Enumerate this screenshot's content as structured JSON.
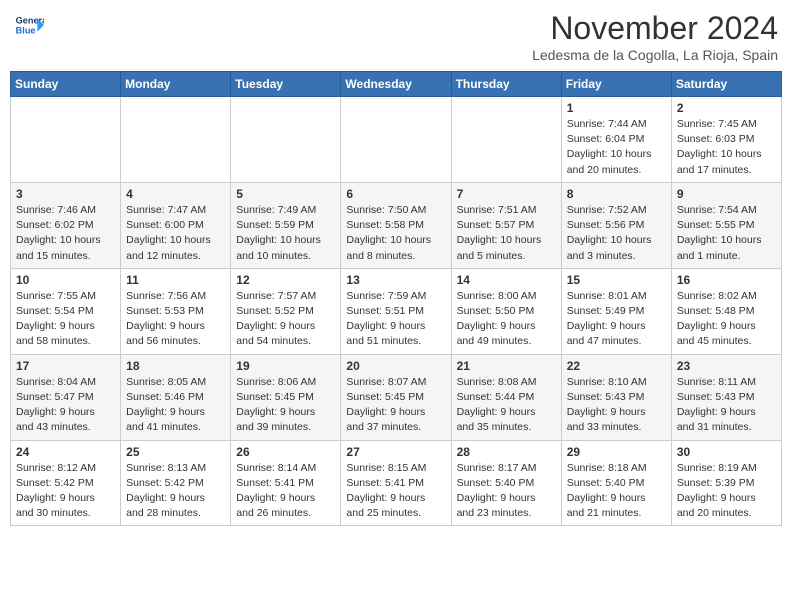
{
  "header": {
    "logo_line1": "General",
    "logo_line2": "Blue",
    "month": "November 2024",
    "location": "Ledesma de la Cogolla, La Rioja, Spain"
  },
  "weekdays": [
    "Sunday",
    "Monday",
    "Tuesday",
    "Wednesday",
    "Thursday",
    "Friday",
    "Saturday"
  ],
  "weeks": [
    [
      {
        "day": "",
        "text": ""
      },
      {
        "day": "",
        "text": ""
      },
      {
        "day": "",
        "text": ""
      },
      {
        "day": "",
        "text": ""
      },
      {
        "day": "",
        "text": ""
      },
      {
        "day": "1",
        "text": "Sunrise: 7:44 AM\nSunset: 6:04 PM\nDaylight: 10 hours and 20 minutes."
      },
      {
        "day": "2",
        "text": "Sunrise: 7:45 AM\nSunset: 6:03 PM\nDaylight: 10 hours and 17 minutes."
      }
    ],
    [
      {
        "day": "3",
        "text": "Sunrise: 7:46 AM\nSunset: 6:02 PM\nDaylight: 10 hours and 15 minutes."
      },
      {
        "day": "4",
        "text": "Sunrise: 7:47 AM\nSunset: 6:00 PM\nDaylight: 10 hours and 12 minutes."
      },
      {
        "day": "5",
        "text": "Sunrise: 7:49 AM\nSunset: 5:59 PM\nDaylight: 10 hours and 10 minutes."
      },
      {
        "day": "6",
        "text": "Sunrise: 7:50 AM\nSunset: 5:58 PM\nDaylight: 10 hours and 8 minutes."
      },
      {
        "day": "7",
        "text": "Sunrise: 7:51 AM\nSunset: 5:57 PM\nDaylight: 10 hours and 5 minutes."
      },
      {
        "day": "8",
        "text": "Sunrise: 7:52 AM\nSunset: 5:56 PM\nDaylight: 10 hours and 3 minutes."
      },
      {
        "day": "9",
        "text": "Sunrise: 7:54 AM\nSunset: 5:55 PM\nDaylight: 10 hours and 1 minute."
      }
    ],
    [
      {
        "day": "10",
        "text": "Sunrise: 7:55 AM\nSunset: 5:54 PM\nDaylight: 9 hours and 58 minutes."
      },
      {
        "day": "11",
        "text": "Sunrise: 7:56 AM\nSunset: 5:53 PM\nDaylight: 9 hours and 56 minutes."
      },
      {
        "day": "12",
        "text": "Sunrise: 7:57 AM\nSunset: 5:52 PM\nDaylight: 9 hours and 54 minutes."
      },
      {
        "day": "13",
        "text": "Sunrise: 7:59 AM\nSunset: 5:51 PM\nDaylight: 9 hours and 51 minutes."
      },
      {
        "day": "14",
        "text": "Sunrise: 8:00 AM\nSunset: 5:50 PM\nDaylight: 9 hours and 49 minutes."
      },
      {
        "day": "15",
        "text": "Sunrise: 8:01 AM\nSunset: 5:49 PM\nDaylight: 9 hours and 47 minutes."
      },
      {
        "day": "16",
        "text": "Sunrise: 8:02 AM\nSunset: 5:48 PM\nDaylight: 9 hours and 45 minutes."
      }
    ],
    [
      {
        "day": "17",
        "text": "Sunrise: 8:04 AM\nSunset: 5:47 PM\nDaylight: 9 hours and 43 minutes."
      },
      {
        "day": "18",
        "text": "Sunrise: 8:05 AM\nSunset: 5:46 PM\nDaylight: 9 hours and 41 minutes."
      },
      {
        "day": "19",
        "text": "Sunrise: 8:06 AM\nSunset: 5:45 PM\nDaylight: 9 hours and 39 minutes."
      },
      {
        "day": "20",
        "text": "Sunrise: 8:07 AM\nSunset: 5:45 PM\nDaylight: 9 hours and 37 minutes."
      },
      {
        "day": "21",
        "text": "Sunrise: 8:08 AM\nSunset: 5:44 PM\nDaylight: 9 hours and 35 minutes."
      },
      {
        "day": "22",
        "text": "Sunrise: 8:10 AM\nSunset: 5:43 PM\nDaylight: 9 hours and 33 minutes."
      },
      {
        "day": "23",
        "text": "Sunrise: 8:11 AM\nSunset: 5:43 PM\nDaylight: 9 hours and 31 minutes."
      }
    ],
    [
      {
        "day": "24",
        "text": "Sunrise: 8:12 AM\nSunset: 5:42 PM\nDaylight: 9 hours and 30 minutes."
      },
      {
        "day": "25",
        "text": "Sunrise: 8:13 AM\nSunset: 5:42 PM\nDaylight: 9 hours and 28 minutes."
      },
      {
        "day": "26",
        "text": "Sunrise: 8:14 AM\nSunset: 5:41 PM\nDaylight: 9 hours and 26 minutes."
      },
      {
        "day": "27",
        "text": "Sunrise: 8:15 AM\nSunset: 5:41 PM\nDaylight: 9 hours and 25 minutes."
      },
      {
        "day": "28",
        "text": "Sunrise: 8:17 AM\nSunset: 5:40 PM\nDaylight: 9 hours and 23 minutes."
      },
      {
        "day": "29",
        "text": "Sunrise: 8:18 AM\nSunset: 5:40 PM\nDaylight: 9 hours and 21 minutes."
      },
      {
        "day": "30",
        "text": "Sunrise: 8:19 AM\nSunset: 5:39 PM\nDaylight: 9 hours and 20 minutes."
      }
    ]
  ]
}
